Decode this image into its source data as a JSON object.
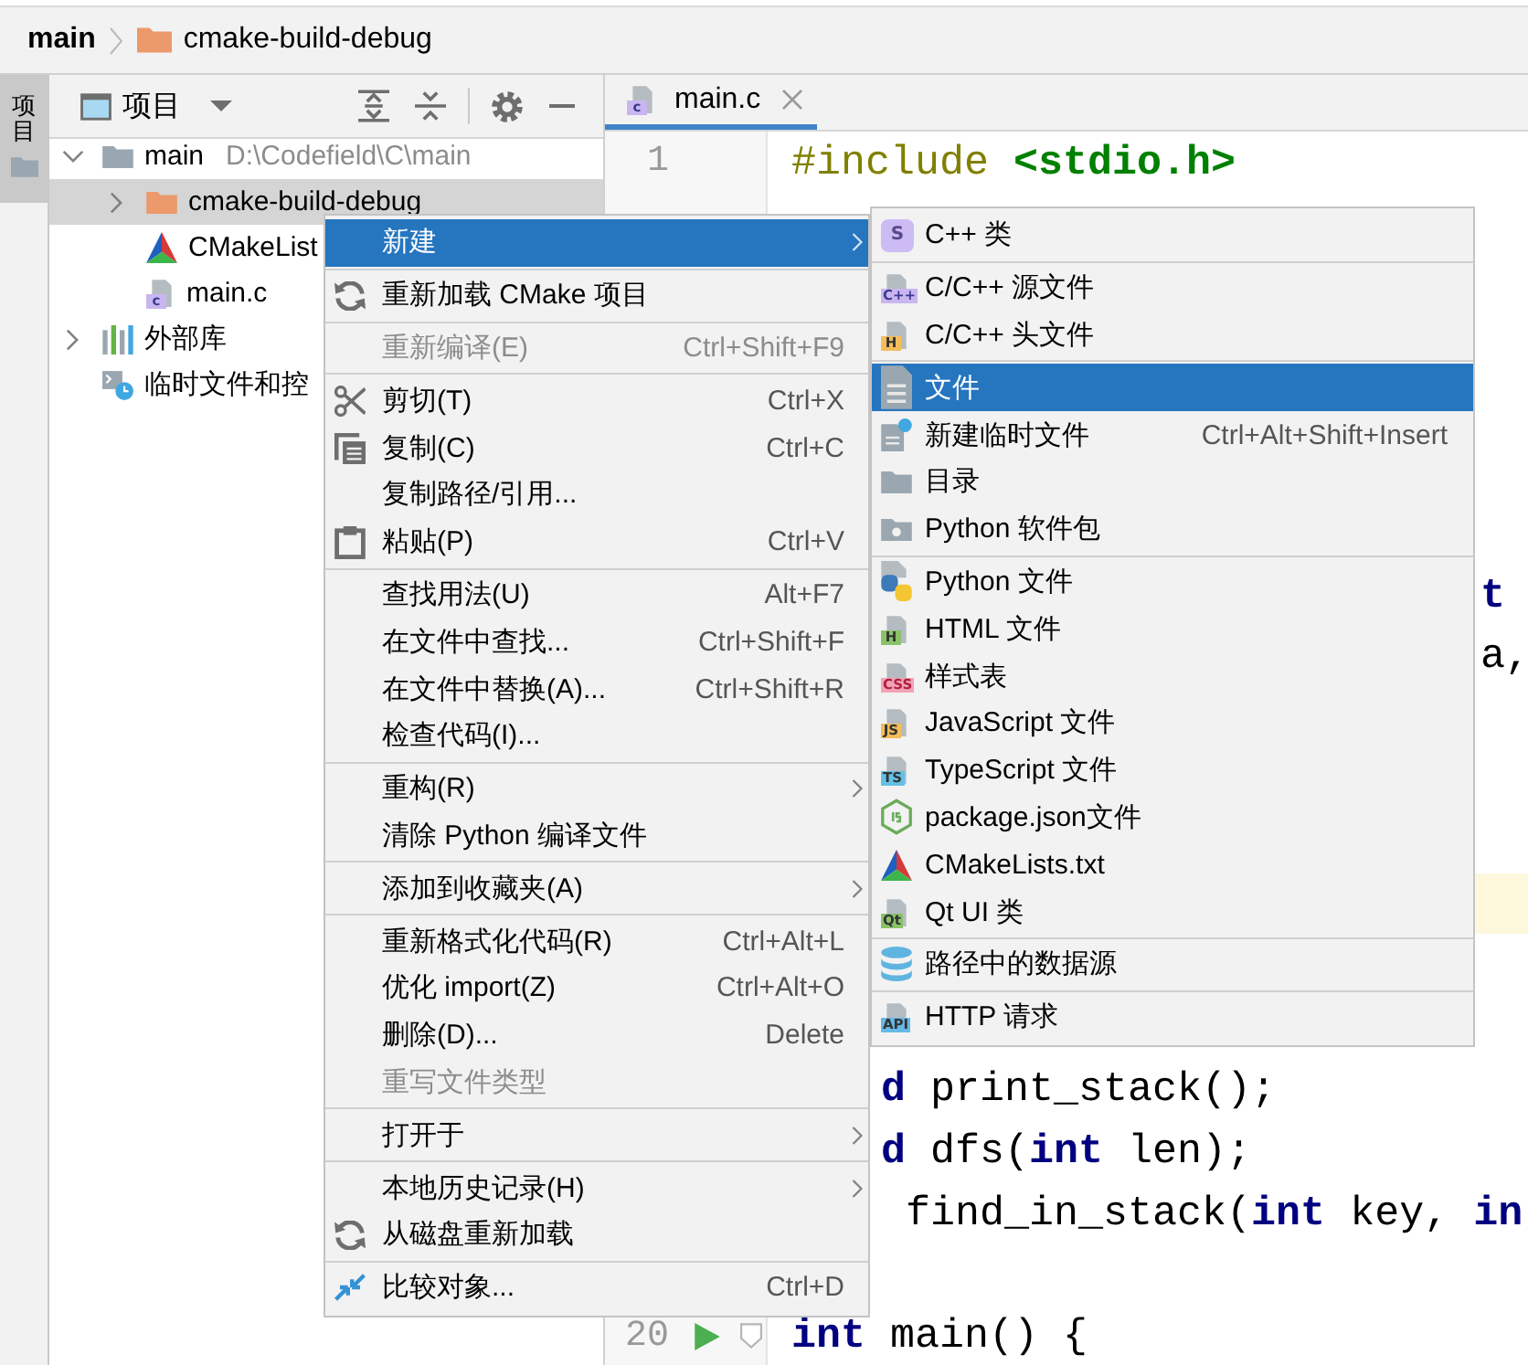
{
  "breadcrumb": [
    {
      "label": "main",
      "kind": "module"
    },
    {
      "label": "cmake-build-debug",
      "kind": "folder"
    }
  ],
  "tool_stripe": [
    {
      "label": "项目",
      "selected": true
    }
  ],
  "project_panel": {
    "title": "项目",
    "tree": [
      {
        "label": "main",
        "path": "D:\\Codefield\\C\\main",
        "kind": "module",
        "expanded": true,
        "selected": false,
        "children": [
          {
            "label": "cmake-build-debug",
            "kind": "folder",
            "expanded": false,
            "selected": true
          },
          {
            "label": "CMakeList",
            "kind": "cmake",
            "selected": false
          },
          {
            "label": "main.c",
            "kind": "csource",
            "badge": "c",
            "selected": false
          }
        ]
      },
      {
        "label": "外部库",
        "kind": "library",
        "expanded": false,
        "selected": false
      },
      {
        "label": "临时文件和控",
        "kind": "scratches",
        "selected": false
      }
    ]
  },
  "editor": {
    "tabs": [
      {
        "label": "main.c",
        "kind": "csource",
        "badge": "c",
        "selected": true
      }
    ],
    "lines": [
      {
        "number": "1",
        "kind": "full",
        "current": false,
        "tokens": [
          {
            "text": "#include ",
            "kind": "directive"
          },
          {
            "text": "<stdio.h>",
            "kind": "header"
          }
        ]
      },
      {
        "kind": "after-submenu",
        "current": false,
        "tokens": [
          {
            "text": "t",
            "kind": "keyword"
          }
        ]
      },
      {
        "kind": "after-submenu",
        "current": false,
        "tokens": [
          {
            "text": "a,",
            "kind": "plain"
          }
        ]
      },
      {
        "current": true
      },
      {
        "kind": "after-menu",
        "current": false,
        "tokens": [
          {
            "text": "d ",
            "kind": "keyword"
          },
          {
            "text": "print_stack();",
            "kind": "plain"
          }
        ]
      },
      {
        "kind": "after-menu",
        "current": false,
        "tokens": [
          {
            "text": "d ",
            "kind": "keyword"
          },
          {
            "text": "dfs(",
            "kind": "plain"
          },
          {
            "text": "int",
            "kind": "keyword"
          },
          {
            "text": " len);",
            "kind": "plain"
          }
        ]
      },
      {
        "kind": "after-menu",
        "current": false,
        "tokens": [
          {
            "text": " find_in_stack(",
            "kind": "plain"
          },
          {
            "text": "int",
            "kind": "keyword"
          },
          {
            "text": " key, ",
            "kind": "plain"
          },
          {
            "text": "in",
            "kind": "keyword"
          }
        ]
      },
      {
        "number": "20",
        "kind": "full",
        "current": false,
        "run": true,
        "fold": true,
        "tokens": [
          {
            "text": "int",
            "kind": "keyword"
          },
          {
            "text": " main() {",
            "kind": "plain"
          }
        ]
      }
    ]
  },
  "context_menu": {
    "groups": [
      [
        {
          "label": "新建",
          "kind": "plain",
          "submenu": true,
          "selected": true,
          "disabled": false
        }
      ],
      [
        {
          "label": "重新加载 CMake 项目",
          "kind": "reload",
          "selected": false,
          "disabled": false
        }
      ],
      [
        {
          "label": "重新编译(E)",
          "shortcut": "Ctrl+Shift+F9",
          "kind": "plain",
          "selected": false,
          "disabled": true
        }
      ],
      [
        {
          "label": "剪切(T)",
          "shortcut": "Ctrl+X",
          "kind": "cut",
          "selected": false,
          "disabled": false
        },
        {
          "label": "复制(C)",
          "shortcut": "Ctrl+C",
          "kind": "copy",
          "selected": false,
          "disabled": false
        },
        {
          "label": "复制路径/引用...",
          "kind": "plain",
          "selected": false,
          "disabled": false
        },
        {
          "label": "粘贴(P)",
          "shortcut": "Ctrl+V",
          "kind": "paste",
          "selected": false,
          "disabled": false
        }
      ],
      [
        {
          "label": "查找用法(U)",
          "shortcut": "Alt+F7",
          "kind": "plain",
          "selected": false,
          "disabled": false
        },
        {
          "label": "在文件中查找...",
          "shortcut": "Ctrl+Shift+F",
          "kind": "plain",
          "selected": false,
          "disabled": false
        },
        {
          "label": "在文件中替换(A)...",
          "shortcut": "Ctrl+Shift+R",
          "kind": "plain",
          "selected": false,
          "disabled": false
        },
        {
          "label": "检查代码(I)...",
          "kind": "plain",
          "selected": false,
          "disabled": false
        }
      ],
      [
        {
          "label": "重构(R)",
          "kind": "plain",
          "submenu": true,
          "selected": false,
          "disabled": false
        },
        {
          "label": "清除 Python 编译文件",
          "kind": "plain",
          "selected": false,
          "disabled": false
        }
      ],
      [
        {
          "label": "添加到收藏夹(A)",
          "kind": "plain",
          "submenu": true,
          "selected": false,
          "disabled": false
        }
      ],
      [
        {
          "label": "重新格式化代码(R)",
          "shortcut": "Ctrl+Alt+L",
          "kind": "plain",
          "selected": false,
          "disabled": false
        },
        {
          "label": "优化 import(Z)",
          "shortcut": "Ctrl+Alt+O",
          "kind": "plain",
          "selected": false,
          "disabled": false
        },
        {
          "label": "删除(D)...",
          "shortcut": "Delete",
          "kind": "plain",
          "selected": false,
          "disabled": false
        },
        {
          "label": "重写文件类型",
          "kind": "plain",
          "selected": false,
          "disabled": true
        }
      ],
      [
        {
          "label": "打开于",
          "kind": "plain",
          "submenu": true,
          "selected": false,
          "disabled": false
        }
      ],
      [
        {
          "label": "本地历史记录(H)",
          "kind": "plain",
          "submenu": true,
          "selected": false,
          "disabled": false
        },
        {
          "label": "从磁盘重新加载",
          "kind": "reload",
          "selected": false,
          "disabled": false
        }
      ],
      [
        {
          "label": "比较对象...",
          "shortcut": "Ctrl+D",
          "kind": "compare",
          "selected": false,
          "disabled": false
        }
      ]
    ]
  },
  "submenu": {
    "groups": [
      [
        {
          "label": "C++ 类",
          "kind": "class",
          "badge": "S",
          "selected": false
        }
      ],
      [
        {
          "label": "C/C++ 源文件",
          "kind": "cppsource",
          "badge": "C++",
          "selected": false
        },
        {
          "label": "C/C++ 头文件",
          "kind": "header",
          "badge": "H",
          "selected": false
        }
      ],
      [
        {
          "label": "文件",
          "kind": "text",
          "selected": true
        },
        {
          "label": "新建临时文件",
          "shortcut": "Ctrl+Alt+Shift+Insert",
          "kind": "scratch",
          "selected": false
        },
        {
          "label": "目录",
          "kind": "directory",
          "selected": false
        },
        {
          "label": "Python 软件包",
          "kind": "package",
          "selected": false
        }
      ],
      [
        {
          "label": "Python 文件",
          "kind": "python",
          "selected": false
        },
        {
          "label": "HTML 文件",
          "kind": "html",
          "badge": "H",
          "selected": false
        },
        {
          "label": "样式表",
          "kind": "css",
          "badge": "CSS",
          "selected": false
        },
        {
          "label": "JavaScript 文件",
          "kind": "js",
          "badge": "JS",
          "selected": false
        },
        {
          "label": "TypeScript 文件",
          "kind": "ts",
          "badge": "TS",
          "selected": false
        },
        {
          "label": "package.json文件",
          "kind": "node",
          "selected": false
        },
        {
          "label": "CMakeLists.txt",
          "kind": "cmake",
          "selected": false
        },
        {
          "label": "Qt UI 类",
          "kind": "qt",
          "badge": "Qt",
          "selected": false
        }
      ],
      [
        {
          "label": "路径中的数据源",
          "kind": "database",
          "selected": false
        }
      ],
      [
        {
          "label": "HTTP 请求",
          "kind": "api",
          "badge": "API",
          "selected": false
        }
      ]
    ]
  }
}
